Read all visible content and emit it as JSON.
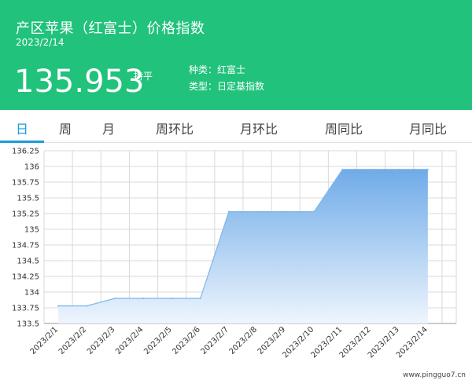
{
  "header": {
    "title": "产区苹果（红富士）价格指数",
    "date": "2023/2/14",
    "price": "135.953",
    "trend": "持平",
    "type_line": "种类：红富士",
    "kind_line": "类型：日定基指数"
  },
  "tabs": [
    {
      "label": "日",
      "active": true
    },
    {
      "label": "周",
      "active": false
    },
    {
      "label": "月",
      "active": false
    },
    {
      "label": "周环比",
      "active": false
    },
    {
      "label": "月环比",
      "active": false
    },
    {
      "label": "周同比",
      "active": false
    },
    {
      "label": "月同比",
      "active": false
    }
  ],
  "colors": {
    "header_bg": "#21c27c",
    "active_tab": "#1a9bd7",
    "area_top": "#6fabe8",
    "area_bottom": "#eef5fd",
    "line": "#7db6ea"
  },
  "chart_data": {
    "type": "area",
    "x": [
      "2023/2/1",
      "2023/2/2",
      "2023/2/3",
      "2023/2/4",
      "2023/2/5",
      "2023/2/6",
      "2023/2/7",
      "2023/2/8",
      "2023/2/9",
      "2023/2/10",
      "2023/2/11",
      "2023/2/12",
      "2023/2/13",
      "2023/2/14"
    ],
    "values": [
      133.78,
      133.78,
      133.9,
      133.9,
      133.9,
      133.9,
      135.28,
      135.28,
      135.28,
      135.28,
      135.953,
      135.953,
      135.953,
      135.953
    ],
    "y_ticks": [
      "136.25",
      "136",
      "135.75",
      "135.5",
      "135.25",
      "135",
      "134.75",
      "134.5",
      "134.25",
      "134",
      "133.75",
      "133.5"
    ],
    "ylim": [
      133.5,
      136.25
    ],
    "grid": true,
    "watermark": "www.pingguo7.cn"
  }
}
